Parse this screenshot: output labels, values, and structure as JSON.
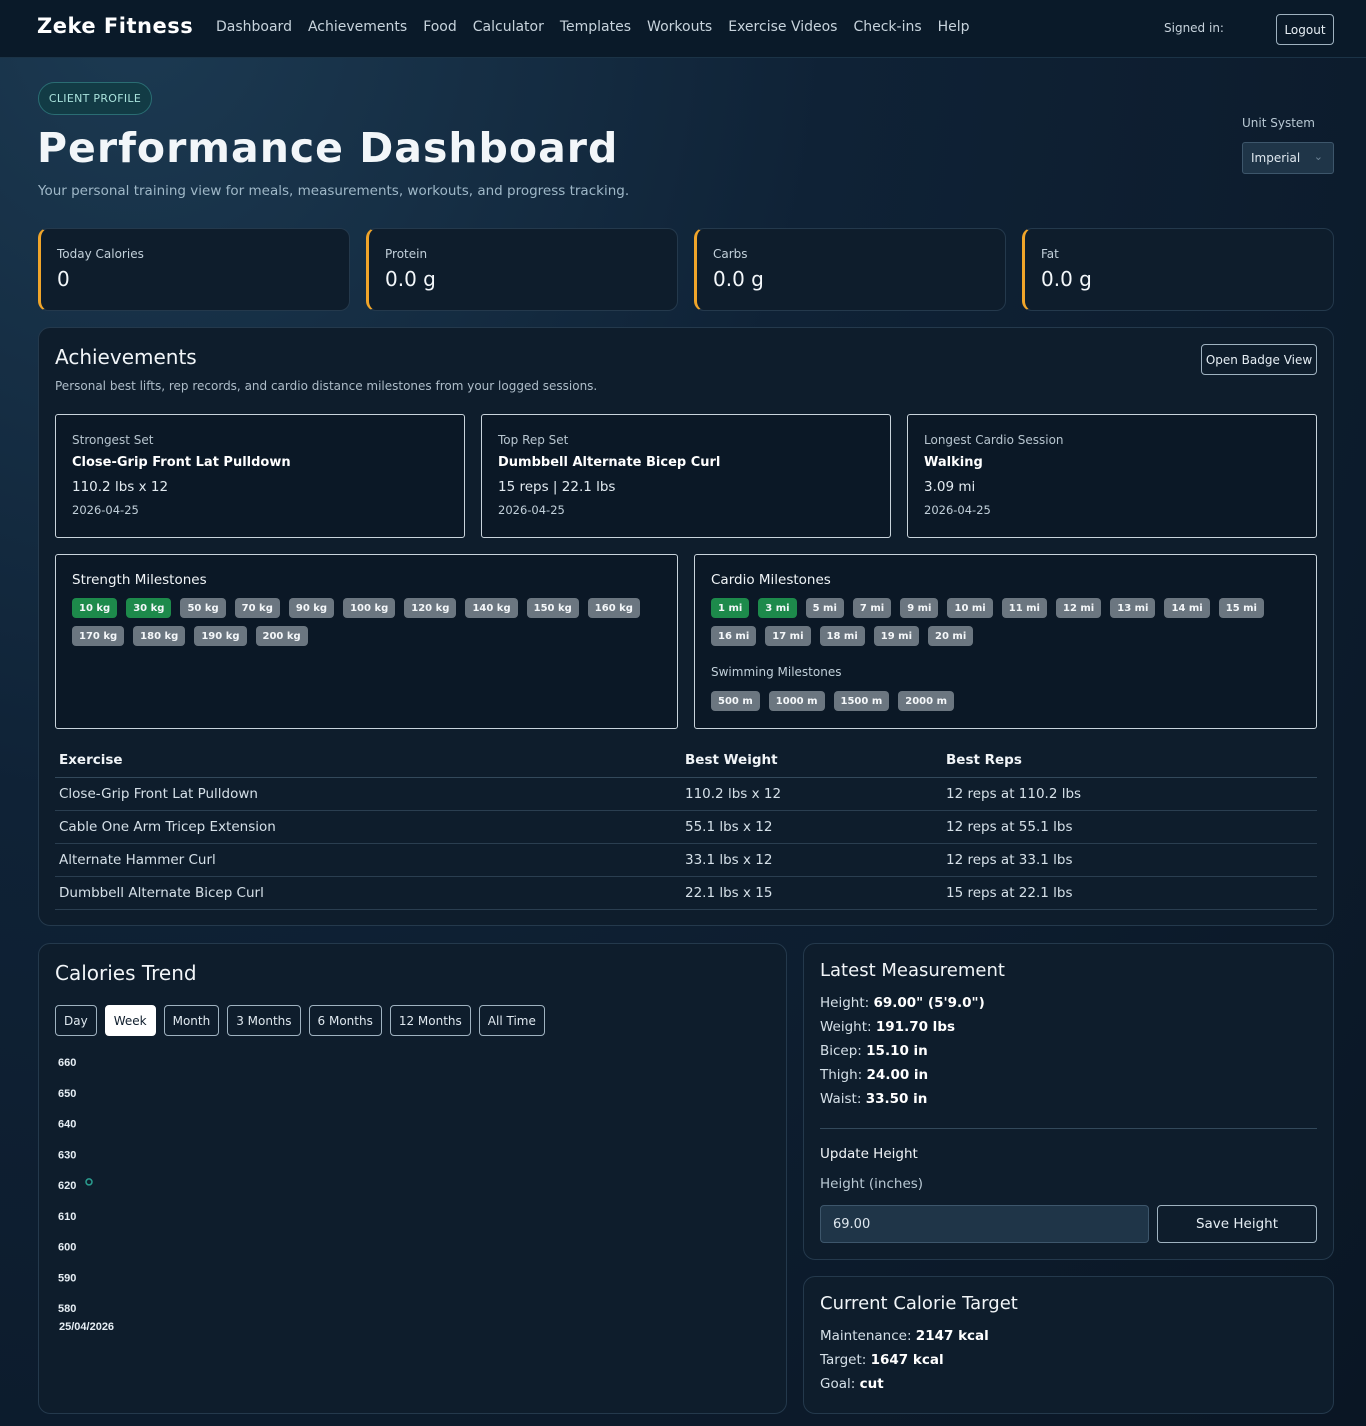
{
  "nav": {
    "brand": "Zeke Fitness",
    "links": [
      "Dashboard",
      "Achievements",
      "Food",
      "Calculator",
      "Templates",
      "Workouts",
      "Exercise Videos",
      "Check-ins",
      "Help"
    ],
    "signed_in_label": "Signed in:",
    "logout_label": "Logout"
  },
  "header": {
    "pill": "CLIENT PROFILE",
    "title": "Performance Dashboard",
    "subtitle": "Your personal training view for meals, measurements, workouts, and progress tracking.",
    "unit_label": "Unit System",
    "unit_value": "Imperial"
  },
  "stats": [
    {
      "label": "Today Calories",
      "value": "0"
    },
    {
      "label": "Protein",
      "value": "0.0 g"
    },
    {
      "label": "Carbs",
      "value": "0.0 g"
    },
    {
      "label": "Fat",
      "value": "0.0 g"
    }
  ],
  "colors": {
    "accent": "#f0a52a",
    "chip_on": "#1d8a4b",
    "chip_off": "#6b7680",
    "chart_point": "#2a9d8f"
  },
  "achievements": {
    "title": "Achievements",
    "subtitle": "Personal best lifts, rep records, and cardio distance milestones from your logged sessions.",
    "badge_button": "Open Badge View",
    "highlights": [
      {
        "label": "Strongest Set",
        "name": "Close-Grip Front Lat Pulldown",
        "value": "110.2 lbs x 12",
        "date": "2026-04-25"
      },
      {
        "label": "Top Rep Set",
        "name": "Dumbbell Alternate Bicep Curl",
        "value": "15 reps | 22.1 lbs",
        "date": "2026-04-25"
      },
      {
        "label": "Longest Cardio Session",
        "name": "Walking",
        "value": "3.09 mi",
        "date": "2026-04-25"
      }
    ],
    "strength_title": "Strength Milestones",
    "strength": [
      {
        "label": "10 kg",
        "achieved": true
      },
      {
        "label": "30 kg",
        "achieved": true
      },
      {
        "label": "50 kg",
        "achieved": false
      },
      {
        "label": "70 kg",
        "achieved": false
      },
      {
        "label": "90 kg",
        "achieved": false
      },
      {
        "label": "100 kg",
        "achieved": false
      },
      {
        "label": "120 kg",
        "achieved": false
      },
      {
        "label": "140 kg",
        "achieved": false
      },
      {
        "label": "150 kg",
        "achieved": false
      },
      {
        "label": "160 kg",
        "achieved": false
      },
      {
        "label": "170 kg",
        "achieved": false
      },
      {
        "label": "180 kg",
        "achieved": false
      },
      {
        "label": "190 kg",
        "achieved": false
      },
      {
        "label": "200 kg",
        "achieved": false
      }
    ],
    "cardio_title": "Cardio Milestones",
    "cardio": [
      {
        "label": "1 mi",
        "achieved": true
      },
      {
        "label": "3 mi",
        "achieved": true
      },
      {
        "label": "5 mi",
        "achieved": false
      },
      {
        "label": "7 mi",
        "achieved": false
      },
      {
        "label": "9 mi",
        "achieved": false
      },
      {
        "label": "10 mi",
        "achieved": false
      },
      {
        "label": "11 mi",
        "achieved": false
      },
      {
        "label": "12 mi",
        "achieved": false
      },
      {
        "label": "13 mi",
        "achieved": false
      },
      {
        "label": "14 mi",
        "achieved": false
      },
      {
        "label": "15 mi",
        "achieved": false
      },
      {
        "label": "16 mi",
        "achieved": false
      },
      {
        "label": "17 mi",
        "achieved": false
      },
      {
        "label": "18 mi",
        "achieved": false
      },
      {
        "label": "19 mi",
        "achieved": false
      },
      {
        "label": "20 mi",
        "achieved": false
      }
    ],
    "swim_title": "Swimming Milestones",
    "swim": [
      {
        "label": "500 m",
        "achieved": false
      },
      {
        "label": "1000 m",
        "achieved": false
      },
      {
        "label": "1500 m",
        "achieved": false
      },
      {
        "label": "2000 m",
        "achieved": false
      }
    ],
    "table": {
      "headers": [
        "Exercise",
        "Best Weight",
        "Best Reps"
      ],
      "rows": [
        [
          "Close-Grip Front Lat Pulldown",
          "110.2 lbs x 12",
          "12 reps at 110.2 lbs"
        ],
        [
          "Cable One Arm Tricep Extension",
          "55.1 lbs x 12",
          "12 reps at 55.1 lbs"
        ],
        [
          "Alternate Hammer Curl",
          "33.1 lbs x 12",
          "12 reps at 33.1 lbs"
        ],
        [
          "Dumbbell Alternate Bicep Curl",
          "22.1 lbs x 15",
          "15 reps at 22.1 lbs"
        ]
      ]
    }
  },
  "calories": {
    "title": "Calories Trend",
    "ranges": [
      "Day",
      "Week",
      "Month",
      "3 Months",
      "6 Months",
      "12 Months",
      "All Time"
    ],
    "active_range": "Week"
  },
  "chart_data": {
    "type": "line",
    "title": "",
    "xlabel": "",
    "ylabel": "",
    "ylim": [
      580,
      660
    ],
    "yticks": [
      660,
      650,
      640,
      630,
      620,
      610,
      600,
      590,
      580
    ],
    "x": [
      "25/04/2026"
    ],
    "series": [
      {
        "values": [
          621
        ]
      }
    ],
    "grid": false,
    "legend": "none"
  },
  "measurement": {
    "title": "Latest Measurement",
    "items": [
      {
        "label": "Height:",
        "value": "69.00\" (5'9.0\")"
      },
      {
        "label": "Weight:",
        "value": "191.70 lbs"
      },
      {
        "label": "Bicep:",
        "value": "15.10 in"
      },
      {
        "label": "Thigh:",
        "value": "24.00 in"
      },
      {
        "label": "Waist:",
        "value": "33.50 in"
      }
    ],
    "update_title": "Update Height",
    "height_label": "Height (inches)",
    "height_value": "69.00",
    "save_label": "Save Height"
  },
  "target": {
    "title": "Current Calorie Target",
    "items": [
      {
        "label": "Maintenance:",
        "value": "2147 kcal"
      },
      {
        "label": "Target:",
        "value": "1647 kcal"
      },
      {
        "label": "Goal:",
        "value": "cut"
      }
    ]
  }
}
